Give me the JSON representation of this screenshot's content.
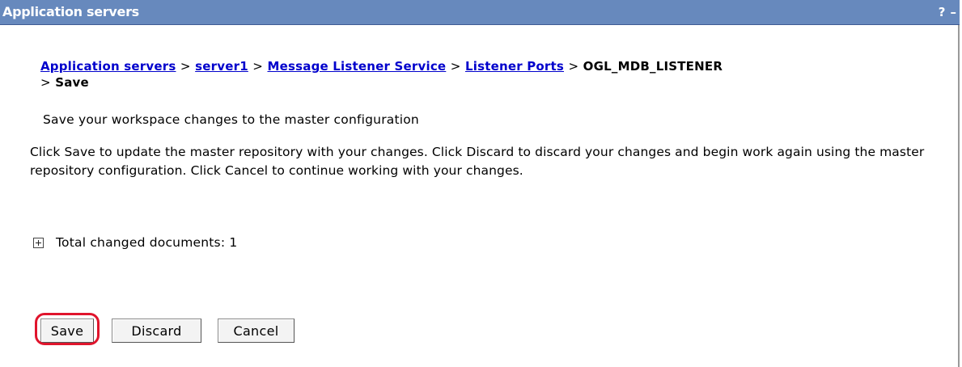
{
  "window": {
    "title": "Application servers",
    "help_glyph": "?",
    "minimize_glyph": "–"
  },
  "breadcrumb": {
    "items": [
      {
        "label": "Application servers"
      },
      {
        "label": "server1"
      },
      {
        "label": "Message Listener Service"
      },
      {
        "label": "Listener Ports"
      }
    ],
    "current": "OGL_MDB_LISTENER",
    "final": "Save",
    "separator": ">"
  },
  "subtitle": "Save your workspace changes to the master configuration",
  "description": "Click Save to update the master repository with your changes. Click Discard to discard your changes and begin work again using the master repository configuration. Click Cancel to continue working with your changes.",
  "changes": {
    "label": "Total changed documents: 1"
  },
  "buttons": {
    "save": "Save",
    "discard": "Discard",
    "cancel": "Cancel"
  },
  "colors": {
    "titlebar": "#6789bd",
    "link": "#0000cc",
    "highlight": "#e0142c"
  }
}
